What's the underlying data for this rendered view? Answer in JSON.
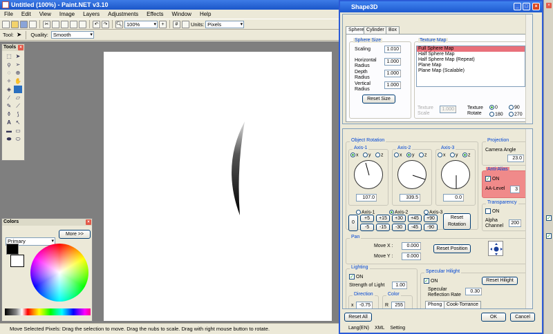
{
  "paintnet": {
    "title": "Untitled (100%) - Paint.NET v3.10",
    "menu": [
      "File",
      "Edit",
      "View",
      "Image",
      "Layers",
      "Adjustments",
      "Effects",
      "Window",
      "Help"
    ],
    "zoom": "100%",
    "units_label": "Units:",
    "units_value": "Pixels",
    "tool_label": "Tool:",
    "quality_label": "Quality:",
    "quality_value": "Smooth",
    "tools_title": "Tools",
    "colors_title": "Colors",
    "colors_mode": "Primary",
    "more_button": "More >>",
    "status": "Move Selected Pixels: Drag the selection to move. Drag the nubs to scale. Drag with right mouse button to rotate."
  },
  "shape3d": {
    "title": "Shape3D",
    "tabs": [
      "Sphere",
      "Cylinder",
      "Box"
    ],
    "sphere_size": {
      "title": "Sphere Size",
      "scaling_label": "Scaling",
      "scaling": "1.010",
      "horizontal_label": "Horizontal Radius",
      "horizontal": "1.000",
      "depth_label": "Depth Radius",
      "depth": "1.000",
      "vertical_label": "Vertical Radius",
      "vertical": "1.000",
      "reset_button": "Reset Size"
    },
    "texture_map": {
      "title": "Texture Map",
      "items": [
        "Full Sphere Map",
        "Half Sphere Map",
        "Half Sphere Map (Repeat)",
        "Plane Map",
        "Plane Map (Scalable)"
      ],
      "selected": "Full Sphere Map",
      "scale_label": "Texture Scale",
      "scale_value": "1.000",
      "rotate_label": "Texture Rotate",
      "rotate_options": [
        "0",
        "90",
        "180",
        "270"
      ]
    },
    "rotation": {
      "title": "Object Rotation",
      "axis1_title": "Axis-1",
      "axis2_title": "Axis-2",
      "axis3_title": "Axis-3",
      "axes": [
        "x",
        "y",
        "z"
      ],
      "axis1_value": "107.0",
      "axis2_value": "339.5",
      "axis3_value": "0.0",
      "axis_choices": [
        "Axis-1",
        "Axis-2",
        "Axis-3"
      ],
      "zero_button": "0",
      "plus": [
        "+5",
        "+15",
        "+30",
        "+45",
        "+90"
      ],
      "minus": [
        "-5",
        "-15",
        "-30",
        "-45",
        "-90"
      ],
      "reset_button": "Reset Rotation"
    },
    "projection": {
      "title": "Projection",
      "camera_label": "Camera Angle",
      "camera_value": "23.0"
    },
    "antialias": {
      "title": "Anti-Alias",
      "on_label": "ON",
      "level_label": "AA-Level",
      "level_value": "3"
    },
    "transparency": {
      "title": "Transparency",
      "on_label": "ON",
      "alpha_label": "Alpha Channel",
      "alpha_value": "200"
    },
    "pan": {
      "title": "Pan",
      "move_x_label": "Move X :",
      "move_x": "0.000",
      "move_y_label": "Move Y :",
      "move_y": "0.000",
      "reset_button": "Reset Position"
    },
    "lighting": {
      "title": "Lighting",
      "on_label": "ON",
      "strength_label": "Strength of Light",
      "strength": "1.00",
      "direction_title": "Direction",
      "dir_x_label": "x",
      "dir_x": "-0.75",
      "color_title": "Color",
      "color_r_label": "R",
      "color_r": "255"
    },
    "specular": {
      "title": "Specular Hilight",
      "on_label": "ON",
      "reset_button": "Reset Hilight",
      "rate_label": "Specular Reflection Rate",
      "rate_value": "0.30",
      "tabs": [
        "Phong",
        "Cook-Torrance"
      ]
    },
    "reset_all": "Reset All",
    "ok": "OK",
    "cancel": "Cancel",
    "footer": [
      "Lang(EN)",
      "XML",
      "Setting"
    ]
  }
}
